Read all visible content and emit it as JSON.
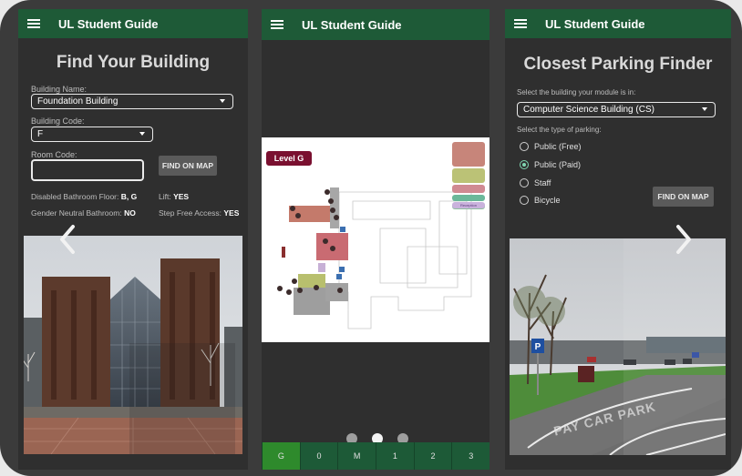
{
  "colors": {
    "appbar": "#1e5a37",
    "accent": "#7fd6b1",
    "level_active": "#2e8a2c",
    "level_badge": "#7a1030"
  },
  "screen1": {
    "app_title": "UL Student Guide",
    "heading": "Find Your Building",
    "building_name_label": "Building Name:",
    "building_name_value": "Foundation Building",
    "building_code_label": "Building Code:",
    "building_code_value": "F",
    "room_code_label": "Room Code:",
    "room_code_value": "",
    "find_button": "FIND ON MAP",
    "disabled_bathroom_label": "Disabled Bathroom Floor:",
    "disabled_bathroom_value": "B, G",
    "lift_label": "Lift:",
    "lift_value": "YES",
    "gender_neutral_label": "Gender Neutral Bathroom:",
    "gender_neutral_value": "NO",
    "step_free_label": "Step Free Access:",
    "step_free_value": "YES",
    "prev_icon": "chevron-left-icon"
  },
  "screen2": {
    "app_title": "UL Student Guide",
    "level_badge": "Level G",
    "legend_items": [
      "",
      "",
      "",
      "",
      "",
      "Reception"
    ],
    "levels": [
      "G",
      "0",
      "M",
      "1",
      "2",
      "3"
    ],
    "active_level": "G",
    "page_dots": 3,
    "active_dot": 1
  },
  "screen3": {
    "app_title": "UL Student Guide",
    "heading": "Closest Parking Finder",
    "building_prompt": "Select the building your module is in:",
    "building_value": "Computer Science Building (CS)",
    "parking_prompt": "Select the type of parking:",
    "parking_options": [
      "Public (Free)",
      "Public (Paid)",
      "Staff",
      "Bicycle"
    ],
    "selected_option": "Public (Paid)",
    "find_button": "FIND ON MAP",
    "sign_text": "PAY CAR PARK",
    "next_icon": "chevron-right-icon"
  }
}
